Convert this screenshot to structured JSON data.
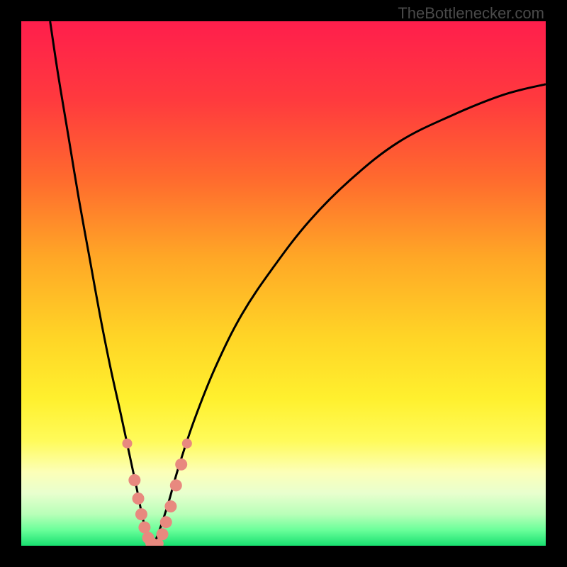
{
  "watermark": "TheBottlenecker.com",
  "chart_data": {
    "type": "line",
    "title": "",
    "xlabel": "",
    "ylabel": "",
    "xlim": [
      0,
      100
    ],
    "ylim": [
      0,
      100
    ],
    "series": [
      {
        "name": "left-curve",
        "type": "line",
        "points": [
          [
            5.5,
            100
          ],
          [
            7,
            90
          ],
          [
            9,
            78
          ],
          [
            11,
            66
          ],
          [
            13,
            55
          ],
          [
            15,
            44
          ],
          [
            17,
            34
          ],
          [
            19,
            25
          ],
          [
            20.5,
            18
          ],
          [
            22,
            11
          ],
          [
            23,
            6
          ],
          [
            24,
            2
          ],
          [
            25,
            0
          ]
        ]
      },
      {
        "name": "right-curve",
        "type": "line",
        "points": [
          [
            25,
            0
          ],
          [
            26,
            2
          ],
          [
            28,
            8
          ],
          [
            30,
            15
          ],
          [
            33,
            24
          ],
          [
            37,
            34
          ],
          [
            42,
            44
          ],
          [
            48,
            53
          ],
          [
            55,
            62
          ],
          [
            63,
            70
          ],
          [
            72,
            77
          ],
          [
            82,
            82
          ],
          [
            92,
            86
          ],
          [
            100,
            88
          ]
        ]
      },
      {
        "name": "left-markers",
        "type": "scatter",
        "points": [
          [
            20.2,
            19.5
          ],
          [
            21.6,
            12.5
          ],
          [
            22.3,
            9.0
          ],
          [
            22.9,
            6.0
          ],
          [
            23.5,
            3.5
          ],
          [
            24.2,
            1.5
          ],
          [
            24.8,
            0.5
          ],
          [
            25.3,
            0.2
          ]
        ]
      },
      {
        "name": "right-markers",
        "type": "scatter",
        "points": [
          [
            26.2,
            0.4
          ],
          [
            26.9,
            2.2
          ],
          [
            27.6,
            4.5
          ],
          [
            28.5,
            7.5
          ],
          [
            29.5,
            11.5
          ],
          [
            30.5,
            15.5
          ],
          [
            31.6,
            19.5
          ]
        ]
      }
    ],
    "gradient_stops": [
      {
        "offset": 0,
        "color": "#ff1e4c"
      },
      {
        "offset": 15,
        "color": "#ff3a3e"
      },
      {
        "offset": 30,
        "color": "#ff6a2e"
      },
      {
        "offset": 45,
        "color": "#ffa726"
      },
      {
        "offset": 60,
        "color": "#ffd426"
      },
      {
        "offset": 72,
        "color": "#fff02e"
      },
      {
        "offset": 80,
        "color": "#fffb5a"
      },
      {
        "offset": 86,
        "color": "#fcffb8"
      },
      {
        "offset": 90,
        "color": "#e8ffce"
      },
      {
        "offset": 94,
        "color": "#b8ffb8"
      },
      {
        "offset": 97,
        "color": "#6aff9a"
      },
      {
        "offset": 100,
        "color": "#18e070"
      }
    ],
    "marker_color": "#e8897f",
    "curve_color": "#000000"
  }
}
